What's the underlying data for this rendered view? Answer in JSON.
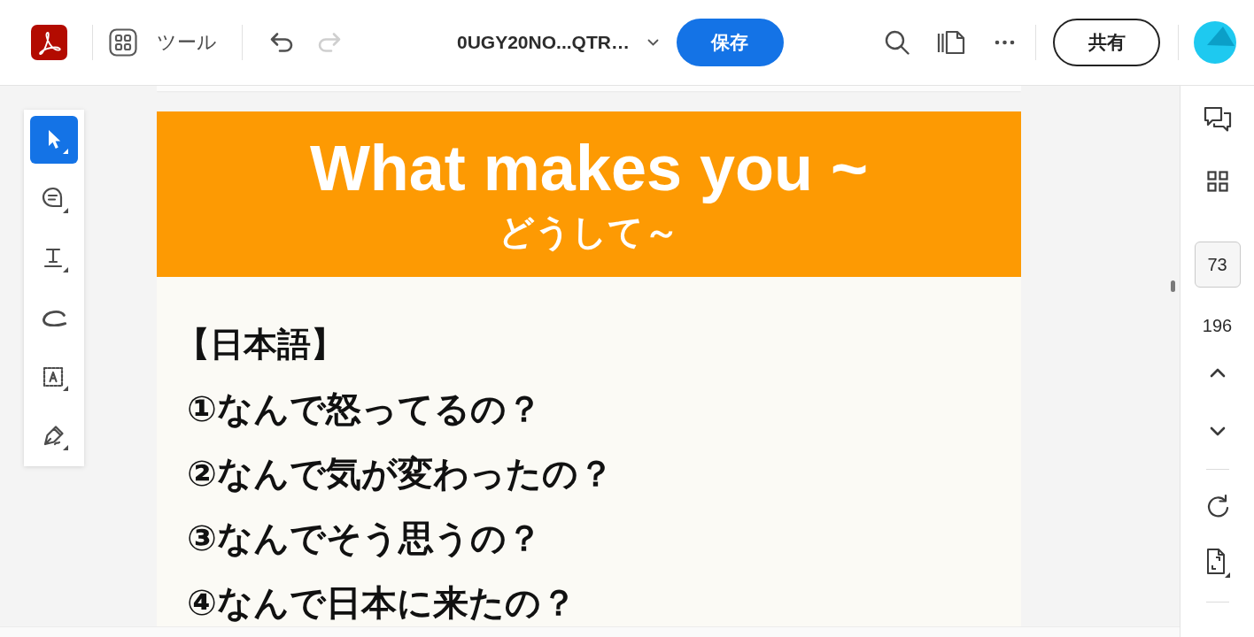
{
  "toolbar": {
    "tools_button": "ツール",
    "undo": {
      "disabled": false
    },
    "redo": {
      "disabled": true
    },
    "filename": "0UGY20NO...QTR…",
    "save_button": "保存",
    "share_button": "共有"
  },
  "tool_rail": {
    "tools": [
      {
        "kind": "select",
        "selected": true
      },
      {
        "kind": "comment",
        "selected": false
      },
      {
        "kind": "text",
        "selected": false
      },
      {
        "kind": "draw",
        "selected": false
      },
      {
        "kind": "text_box",
        "selected": false
      },
      {
        "kind": "sign",
        "selected": false
      }
    ]
  },
  "document": {
    "banner": {
      "title": "What makes you ~",
      "subtitle": "どうして～"
    },
    "heading": "【日本語】",
    "lines": [
      "①なんで怒ってるの？",
      "②なんで気が変わったの？",
      "③なんでそう思うの？",
      "④なんで日本に来たの？"
    ]
  },
  "page_navigation": {
    "current_page": "73",
    "total_pages": "196"
  }
}
